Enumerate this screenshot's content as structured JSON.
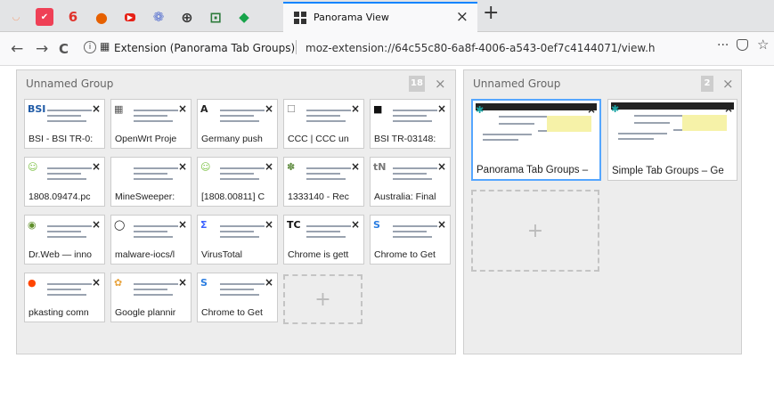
{
  "browser": {
    "pinned_tabs": [
      {
        "icon": "rainbow-app-icon",
        "glyph": "◡",
        "color": "#f2a37c"
      },
      {
        "icon": "pocket-icon",
        "glyph": "✔",
        "color": "#ef4056"
      },
      {
        "icon": "red-swirl-icon",
        "glyph": "6",
        "color": "#e0322b"
      },
      {
        "icon": "firefox-icon",
        "glyph": "●",
        "color": "#e66000"
      },
      {
        "icon": "youtube-icon",
        "glyph": "▶",
        "color": "#e62117"
      },
      {
        "icon": "flower-icon",
        "glyph": "❁",
        "color": "#5f77d1"
      },
      {
        "icon": "globe-icon",
        "glyph": "⊕",
        "color": "#333333"
      },
      {
        "icon": "green-square-icon",
        "glyph": "⊡",
        "color": "#2c7a3a"
      },
      {
        "icon": "green-diamond-icon",
        "glyph": "◆",
        "color": "#17a34a"
      }
    ],
    "active_tab_title": "Panorama View",
    "active_tab_close": "×",
    "new_tab": "+",
    "nav": {
      "back": "←",
      "forward": "→",
      "reload": "C"
    },
    "urlbar": {
      "info": "i",
      "extension_name": "Extension (Panorama Tab Groups)",
      "url": "moz-extension://64c55c80-6a8f-4006-a543-0ef7c4144071/view.h",
      "more": "···",
      "star": "☆"
    }
  },
  "groups": [
    {
      "name": "Unnamed Group",
      "count": "18",
      "close": "×",
      "tabs": [
        {
          "title": "BSI - BSI TR-0:",
          "fav": "BSI",
          "favcolor": "#1f5aa6"
        },
        {
          "title": "OpenWrt Proje",
          "fav": "▦",
          "favcolor": "#555555"
        },
        {
          "title": "Germany push",
          "fav": "A",
          "favcolor": "#222222"
        },
        {
          "title": "CCC | CCC un",
          "fav": "☐",
          "favcolor": "#888888"
        },
        {
          "title": "BSI TR-03148:",
          "fav": "■",
          "favcolor": "#111111"
        },
        {
          "title": "1808.09474.pc",
          "fav": "☺",
          "favcolor": "#7bc043"
        },
        {
          "title": "MineSweeper:",
          "fav": "",
          "favcolor": "#ffffff"
        },
        {
          "title": "[1808.00811] C",
          "fav": "☺",
          "favcolor": "#7bc043"
        },
        {
          "title": "1333140 - Rec",
          "fav": "✽",
          "favcolor": "#5c8a3c"
        },
        {
          "title": "Australia: Final",
          "fav": "tN",
          "favcolor": "#777777"
        },
        {
          "title": "Dr.Web — inno",
          "fav": "◉",
          "favcolor": "#5f8f2a"
        },
        {
          "title": "malware-iocs/l",
          "fav": "◯",
          "favcolor": "#111111"
        },
        {
          "title": "VirusTotal",
          "fav": "Σ",
          "favcolor": "#3b61ff"
        },
        {
          "title": "Chrome is gett",
          "fav": "TC",
          "favcolor": "#111111"
        },
        {
          "title": "Chrome to Get",
          "fav": "S",
          "favcolor": "#2a7de1"
        },
        {
          "title": "pkasting comn",
          "fav": "●",
          "favcolor": "#ff4500"
        },
        {
          "title": "Google plannir",
          "fav": "✿",
          "favcolor": "#e8a33d"
        },
        {
          "title": "Chrome to Get",
          "fav": "S",
          "favcolor": "#2a7de1"
        }
      ],
      "add_label": "+"
    },
    {
      "name": "Unnamed Group",
      "count": "2",
      "close": "×",
      "tabs": [
        {
          "title": "Panorama Tab Groups –",
          "fav": "✱",
          "favcolor": "#1aa3a3"
        },
        {
          "title": "Simple Tab Groups – Ge",
          "fav": "✱",
          "favcolor": "#1aa3a3"
        }
      ],
      "add_label": "+"
    }
  ],
  "colors": {
    "accent": "#0a84ff",
    "active_border": "#55a6ff",
    "group_bg": "#ededed"
  }
}
